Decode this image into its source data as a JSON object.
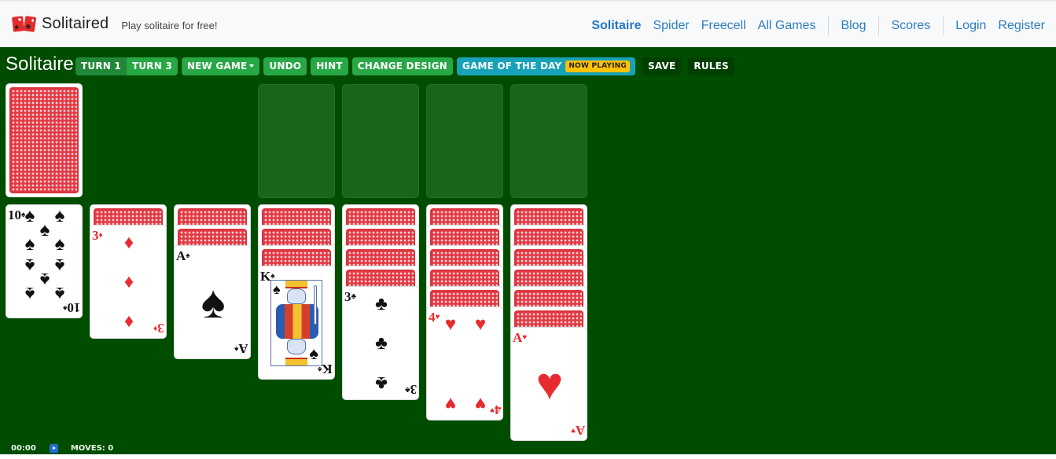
{
  "header": {
    "brand": "Solitaired",
    "tagline": "Play solitaire for free!",
    "logo_icon": "playing-cards-icon",
    "nav": [
      {
        "label": "Solitaire",
        "active": true
      },
      {
        "label": "Spider"
      },
      {
        "label": "Freecell"
      },
      {
        "label": "All Games"
      },
      {
        "label": "Blog"
      },
      {
        "label": "Scores"
      },
      {
        "label": "Login"
      },
      {
        "label": "Register"
      }
    ]
  },
  "game": {
    "title": "Solitaire",
    "toolbar": {
      "turn1": "TURN 1",
      "turn3": "TURN 3",
      "new_game": "NEW GAME",
      "undo": "UNDO",
      "hint": "HINT",
      "change_design": "CHANGE DESIGN",
      "game_of_day": "GAME OF THE DAY",
      "now_playing": "NOW PLAYING",
      "save": "SAVE",
      "rules": "RULES"
    },
    "colors": {
      "felt": "#004d00",
      "button_green": "#28a745",
      "button_info": "#17a2b8",
      "badge_yellow": "#ffc107",
      "card_back_red": "#e23a44",
      "link_blue": "#2d7dc3"
    },
    "stock": {
      "face_down": true
    },
    "foundations": [
      {
        "empty": true
      },
      {
        "empty": true
      },
      {
        "empty": true
      },
      {
        "empty": true
      }
    ],
    "tableau": [
      {
        "face_down_count": 0,
        "top": {
          "rank": "10",
          "suit": "♠",
          "color": "black"
        }
      },
      {
        "face_down_count": 1,
        "top": {
          "rank": "3",
          "suit": "♦",
          "color": "red"
        }
      },
      {
        "face_down_count": 2,
        "top": {
          "rank": "A",
          "suit": "♠",
          "color": "black"
        }
      },
      {
        "face_down_count": 3,
        "top": {
          "rank": "K",
          "suit": "♠",
          "color": "black"
        }
      },
      {
        "face_down_count": 4,
        "top": {
          "rank": "3",
          "suit": "♣",
          "color": "black"
        }
      },
      {
        "face_down_count": 5,
        "top": {
          "rank": "4",
          "suit": "♥",
          "color": "red"
        }
      },
      {
        "face_down_count": 6,
        "top": {
          "rank": "A",
          "suit": "♥",
          "color": "red"
        }
      }
    ],
    "status": {
      "time": "00:00",
      "moves": "MOVES: 0"
    }
  }
}
